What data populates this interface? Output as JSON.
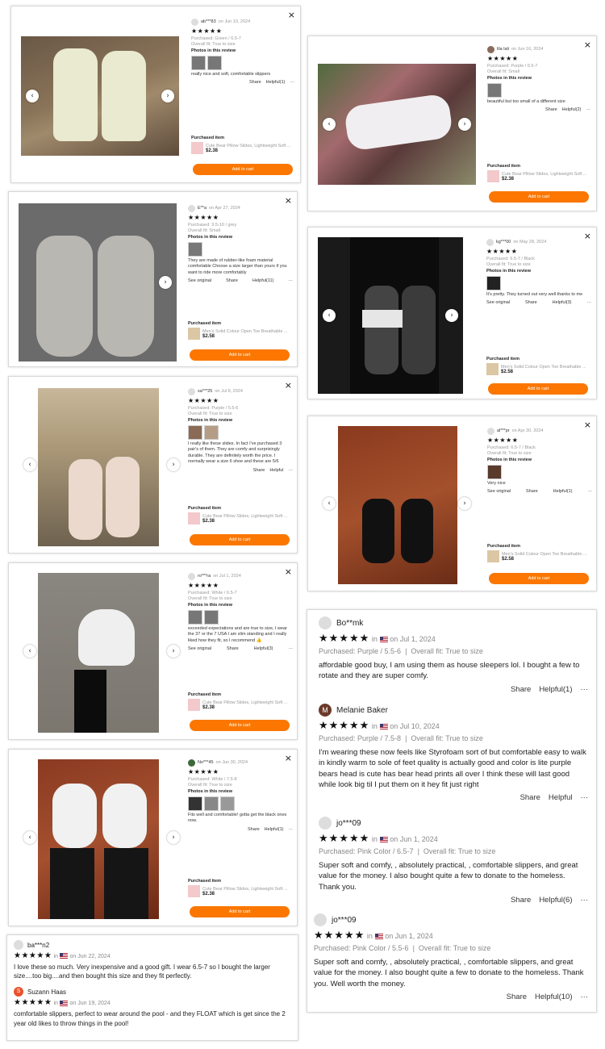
{
  "common": {
    "close": "×",
    "share": "Share",
    "see_original": "See original",
    "photos_heading": "Photos in this review",
    "purchased_heading": "Purchased item",
    "add_to_cart": "Add to cart",
    "more": "···",
    "prev": "‹",
    "next": "›",
    "stars5": "★★★★★",
    "star_color": "#111111",
    "accent": "#fb7701"
  },
  "cards": [
    {
      "user": "ab***83",
      "date": "on Jun 10, 2024",
      "purchased": "Purchased: Green / 6.5-7",
      "fit": "Overall fit: True to size",
      "text": "really nice and soft, comfortable slippers",
      "helpful": "Helpful(1)",
      "product": "Cute Bear Pillow Slides, Lightweight Soft ...",
      "price": "$2.38"
    },
    {
      "user": "lila lali",
      "date": "on Jun 16, 2024",
      "purchased": "Purchased: Purple / 6.5-7",
      "fit": "Overall fit: Small",
      "text": "beautiful but too small of a different size",
      "helpful": "Helpful(2)",
      "product": "Cute Bear Pillow Slides, Lightweight Soft ...",
      "price": "$2.38"
    },
    {
      "user": "E**a",
      "date": "on Apr 27, 2024",
      "purchased": "Purchased: 9.5-10 / grey",
      "fit": "Overall fit: Small",
      "text": "They are made of rubber-like foam material comfortable Choose a size larger than yours if you want to ride more comfortably",
      "helpful": "Helpful(11)",
      "product": "Men's Solid Colour Open Toe Breathable ...",
      "price": "$2.58"
    },
    {
      "user": "kg***00",
      "date": "on May 28, 2024",
      "purchased": "Purchased: 6.5-7 / Black",
      "fit": "Overall fit: True to size",
      "text": "It's pretty. They turned out very well thanks to me",
      "helpful": "Helpful(3)",
      "product": "Men's Solid Colour Open Toe Breathable ...",
      "price": "$2.58"
    },
    {
      "user": "sa***25",
      "date": "on Jul 8, 2024",
      "purchased": "Purchased: Purple / 5.5-6",
      "fit": "Overall fit: True to size",
      "text": "I really like these slides. In fact I've purchased 3 pair's of them. They are comfy and surprisingly durable. They are definitely worth the price. I normally wear a size 6 shoe and these are 5/6",
      "helpful": "Helpful",
      "product": "Cute Bear Pillow Slides, Lightweight Soft ...",
      "price": "$2.38"
    },
    {
      "user": "al***pr",
      "date": "on Apr 30, 2024",
      "purchased": "Purchased: 6.5-7 / Black",
      "fit": "Overall fit: True to size",
      "text": "Very nice",
      "helpful": "Helpful(1)",
      "product": "Men's Solid Colour Open Toe Breathable ...",
      "price": "$2.58"
    },
    {
      "user": "ro***ra",
      "date": "on Jul 1, 2024",
      "purchased": "Purchased: White / 6.5-7",
      "fit": "Overall fit: True to size",
      "text": "exceeded expectations and are true to size, I wear the 37 or the 7 USA I am slim standing and I really liked how they fit, so I recommend 👍",
      "helpful": "Helpful(3)",
      "product": "Cute Bear Pillow Slides, Lightweight Soft ...",
      "price": "$2.38"
    },
    {
      "user": "No***45",
      "date": "on Jun 30, 2024",
      "purchased": "Purchased: White / 7.5-8",
      "fit": "Overall fit: True to size",
      "text": "Fits well and comfortable! gotta get the black ones now.",
      "helpful": "Helpful(1)",
      "product": "Cute Bear Pillow Slides, Lightweight Soft ...",
      "price": "$2.38"
    }
  ],
  "bottom_left": [
    {
      "user": "ba***n2",
      "in": "in",
      "date": "on Jun 22, 2024",
      "text": "I love these so much. Very inexpensive and a good gift. I wear 6.5-7 so I bought the larger size....too big....and then bought this size and they fit perfectly."
    },
    {
      "user": "Suzann Haas",
      "initial": "S",
      "in": "in",
      "date": "on Jun 19, 2024",
      "text": "comfortable slippers, perfect to wear around the pool - and they FLOAT which is get since the 2 year old likes to throw things in the pool!"
    }
  ],
  "bottom_right": [
    {
      "user": "Bo**mk",
      "in": "in",
      "date": "on Jul 1, 2024",
      "purchased": "Purchased: Purple / 5.5-6",
      "fit": "Overall fit: True to size",
      "text": "affordable good buy, I am using them as house sleepers lol. I bought a few to rotate and they are super comfy.",
      "helpful": "Helpful(1)"
    },
    {
      "user": "Melanie Baker",
      "initial": "M",
      "in": "in",
      "date": "on Jul 10, 2024",
      "purchased": "Purchased: Purple / 7.5-8",
      "fit": "Overall fit: True to size",
      "text": "I'm wearing these now feels like Styrofoam sort of but comfortable easy to walk in kindly warm to sole of feet quality is actually good and color is lite purple bears head is cute has bear head prints all over I think these will last good while look big til I put them on it hey fit just right",
      "helpful": "Helpful"
    },
    {
      "user": "jo***09",
      "in": "in",
      "date": "on Jun 1, 2024",
      "purchased": "Purchased: Pink Color / 6.5-7",
      "fit": "Overall fit: True to size",
      "text": "Super soft and comfy, , absolutely practical, , comfortable slippers, and great value for the money. I also bought quite a few to donate to the homeless. Thank you.",
      "helpful": "Helpful(6)"
    },
    {
      "user": "jo***09",
      "in": "in",
      "date": "on Jun 1, 2024",
      "purchased": "Purchased: Pink Color / 5.5-6",
      "fit": "Overall fit: True to size",
      "text": "Super soft and comfy, , absolutely practical, , comfortable slippers, and great value for the money. I also bought quite a few to donate to the homeless. Thank you. Well worth the money.",
      "helpful": "Helpful(10)"
    }
  ]
}
